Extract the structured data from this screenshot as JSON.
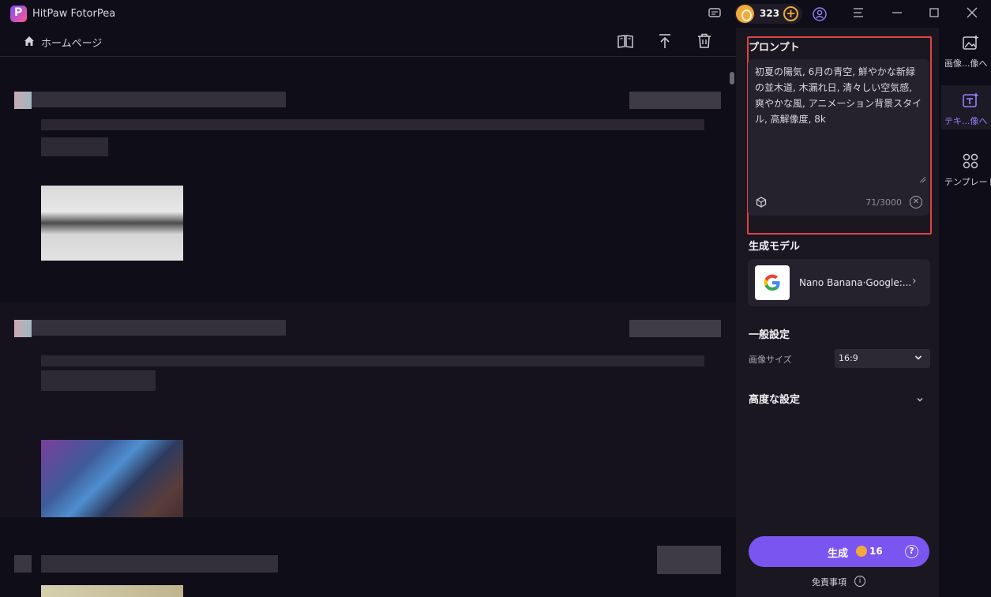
{
  "app": {
    "name": "HitPaw FotorPea",
    "credits": "323"
  },
  "header": {
    "home_label": "ホームページ"
  },
  "panel": {
    "prompt_title": "プロンプト",
    "prompt_text": "初夏の陽気, 6月の青空, 鮮やかな新緑の並木道, 木漏れ日, 清々しい空気感, 爽やかな風, アニメーション背景スタイル, 高解像度, 8k",
    "prompt_counter": "71/3000",
    "model_title": "生成モデル",
    "model_name": "Nano Banana·Google:...",
    "general_title": "一般設定",
    "size_label": "画像サイズ",
    "size_value": "16:9",
    "advanced_title": "高度な設定",
    "generate_label": "生成",
    "generate_cost": "16",
    "disclaimer": "免責事項"
  },
  "rail": {
    "items": [
      {
        "label": "画像...像へ"
      },
      {
        "label": "テキ...像へ"
      },
      {
        "label": "テンプレート"
      }
    ]
  },
  "colors": {
    "accent": "#7a55f0",
    "coin": "#f1a93a",
    "highlight": "#e04444"
  }
}
